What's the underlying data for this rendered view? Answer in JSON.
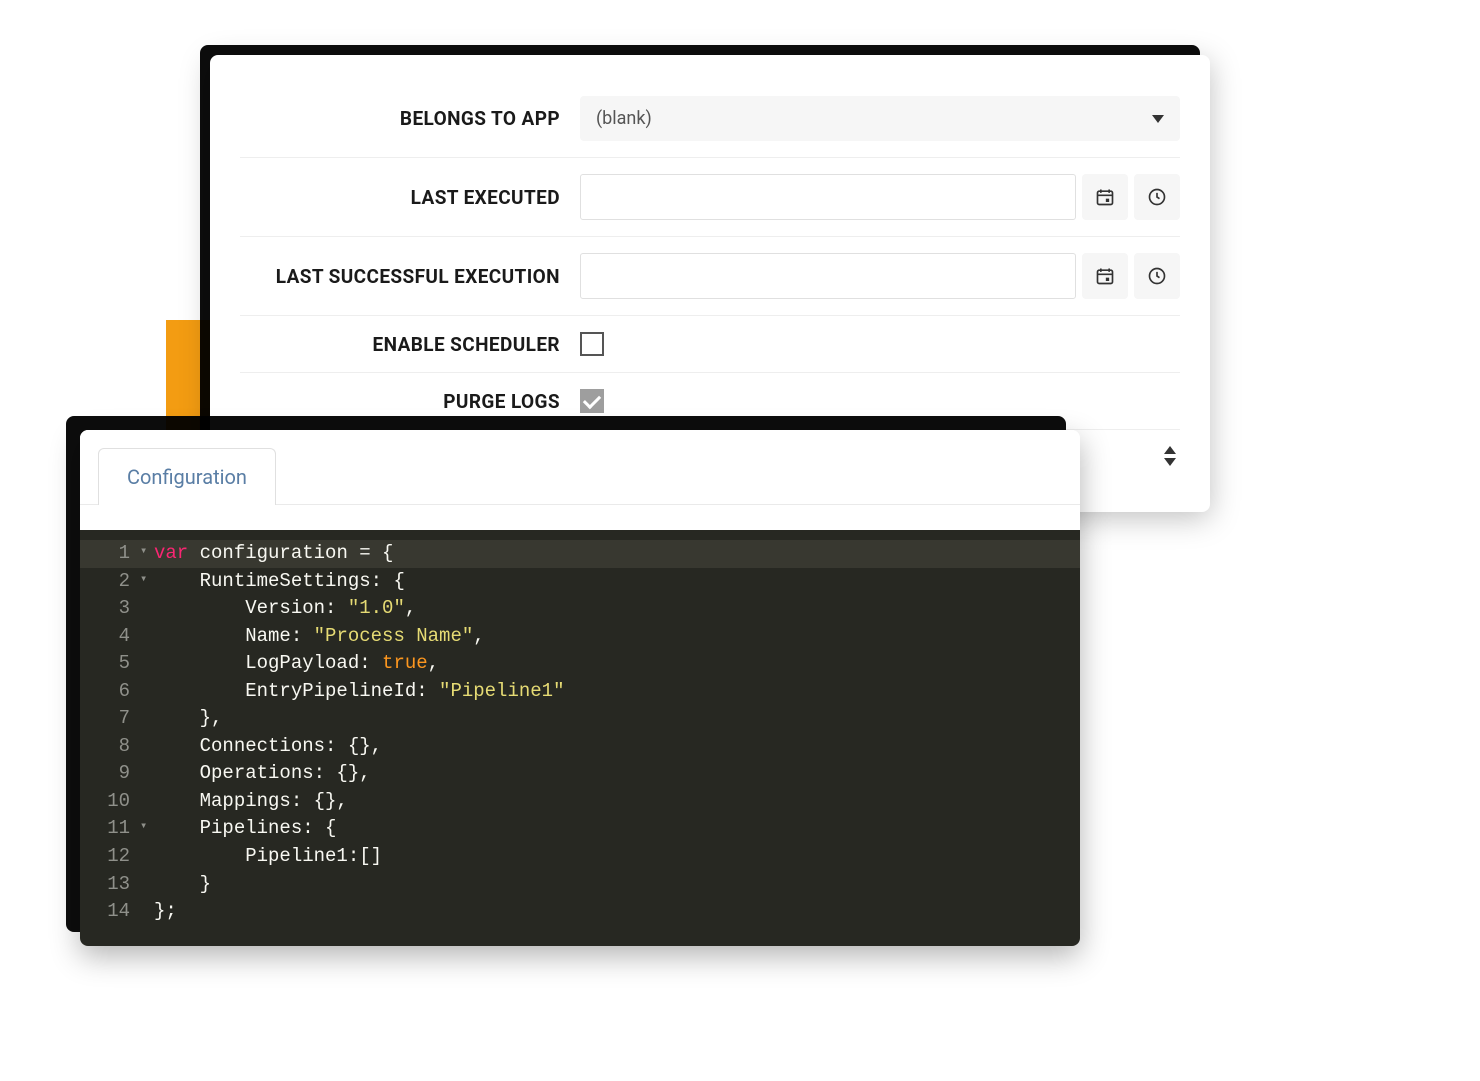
{
  "form": {
    "belongs_to_app": {
      "label": "BELONGS TO APP",
      "value": "(blank)"
    },
    "last_executed": {
      "label": "LAST EXECUTED",
      "value": ""
    },
    "last_successful": {
      "label": "LAST SUCCESSFUL EXECUTION",
      "value": ""
    },
    "enable_scheduler": {
      "label": "ENABLE SCHEDULER",
      "checked": false
    },
    "purge_logs": {
      "label": "PURGE LOGS",
      "checked": true
    }
  },
  "tabs": {
    "configuration": "Configuration"
  },
  "code": {
    "lines": [
      {
        "n": 1,
        "fold": "▾",
        "tokens": [
          [
            "kw",
            "var"
          ],
          [
            "id",
            " configuration = {"
          ]
        ]
      },
      {
        "n": 2,
        "fold": "▾",
        "tokens": [
          [
            "id",
            "    RuntimeSettings: {"
          ]
        ]
      },
      {
        "n": 3,
        "fold": "",
        "tokens": [
          [
            "id",
            "        Version: "
          ],
          [
            "str",
            "\"1.0\""
          ],
          [
            "id",
            ","
          ]
        ]
      },
      {
        "n": 4,
        "fold": "",
        "tokens": [
          [
            "id",
            "        Name: "
          ],
          [
            "str",
            "\"Process Name\""
          ],
          [
            "id",
            ","
          ]
        ]
      },
      {
        "n": 5,
        "fold": "",
        "tokens": [
          [
            "id",
            "        LogPayload: "
          ],
          [
            "bool",
            "true"
          ],
          [
            "id",
            ","
          ]
        ]
      },
      {
        "n": 6,
        "fold": "",
        "tokens": [
          [
            "id",
            "        EntryPipelineId: "
          ],
          [
            "str",
            "\"Pipeline1\""
          ]
        ]
      },
      {
        "n": 7,
        "fold": "",
        "tokens": [
          [
            "id",
            "    },"
          ]
        ]
      },
      {
        "n": 8,
        "fold": "",
        "tokens": [
          [
            "id",
            "    Connections: {},"
          ]
        ]
      },
      {
        "n": 9,
        "fold": "",
        "tokens": [
          [
            "id",
            "    Operations: {},"
          ]
        ]
      },
      {
        "n": 10,
        "fold": "",
        "tokens": [
          [
            "id",
            "    Mappings: {},"
          ]
        ]
      },
      {
        "n": 11,
        "fold": "▾",
        "tokens": [
          [
            "id",
            "    Pipelines: {"
          ]
        ]
      },
      {
        "n": 12,
        "fold": "",
        "tokens": [
          [
            "id",
            "        Pipeline1:[]"
          ]
        ]
      },
      {
        "n": 13,
        "fold": "",
        "tokens": [
          [
            "id",
            "    }"
          ]
        ]
      },
      {
        "n": 14,
        "fold": "",
        "tokens": [
          [
            "id",
            "};"
          ]
        ]
      }
    ]
  }
}
